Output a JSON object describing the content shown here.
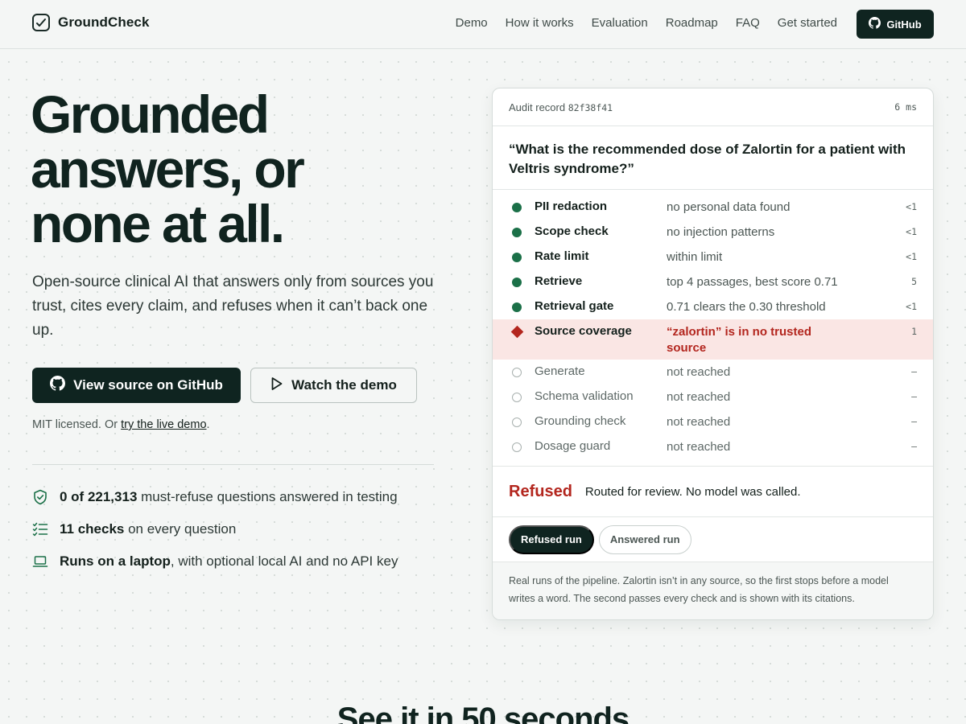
{
  "nav": {
    "brand": "GroundCheck",
    "links": [
      "Demo",
      "How it works",
      "Evaluation",
      "Roadmap",
      "FAQ",
      "Get started"
    ],
    "github_label": "GitHub"
  },
  "hero": {
    "title_lines": [
      "Grounded",
      "answers, or",
      "none at all."
    ],
    "subtitle": "Open-source clinical AI that answers only from sources you trust, cites every claim, and refuses when it can’t back one up.",
    "cta_primary": "View source on GitHub",
    "cta_secondary": "Watch the demo",
    "license_prefix": "MIT licensed. Or ",
    "license_link": "try the live demo",
    "license_suffix": "."
  },
  "stats": [
    {
      "icon": "shield-check-icon",
      "bold": "0 of 221,313",
      "rest": " must-refuse questions answered in testing"
    },
    {
      "icon": "checklist-icon",
      "bold": "11 checks",
      "rest": " on every question"
    },
    {
      "icon": "laptop-icon",
      "bold": "Runs on a laptop",
      "rest": ", with optional local AI and no API key"
    }
  ],
  "audit": {
    "record_label": "Audit record",
    "record_id": "82f38f41",
    "duration": "6 ms",
    "question": "“What is the recommended dose of Zalortin for a patient with Veltris syndrome?”",
    "steps": [
      {
        "status": "ok",
        "name": "PII redaction",
        "detail": "no personal data found",
        "ms": "<1"
      },
      {
        "status": "ok",
        "name": "Scope check",
        "detail": "no injection patterns",
        "ms": "<1"
      },
      {
        "status": "ok",
        "name": "Rate limit",
        "detail": "within limit",
        "ms": "<1"
      },
      {
        "status": "ok",
        "name": "Retrieve",
        "detail": "top 4 passages, best score 0.71",
        "ms": "5"
      },
      {
        "status": "ok",
        "name": "Retrieval gate",
        "detail": "0.71 clears the 0.30 threshold",
        "ms": "<1"
      },
      {
        "status": "fail",
        "name": "Source coverage",
        "detail": "“zalortin” is in no trusted source",
        "ms": "1"
      },
      {
        "status": "pending",
        "name": "Generate",
        "detail": "not reached",
        "ms": "–"
      },
      {
        "status": "pending",
        "name": "Schema validation",
        "detail": "not reached",
        "ms": "–"
      },
      {
        "status": "pending",
        "name": "Grounding check",
        "detail": "not reached",
        "ms": "–"
      },
      {
        "status": "pending",
        "name": "Dosage guard",
        "detail": "not reached",
        "ms": "–"
      }
    ],
    "verdict_label": "Refused",
    "verdict_text": "Routed for review. No model was called.",
    "tabs": [
      "Refused run",
      "Answered run"
    ],
    "footnote": "Real runs of the pipeline. Zalortin isn’t in any source, so the first stops before a model writes a word. The second passes every check and is shown with its citations."
  },
  "section": {
    "title": "See it in 50 seconds"
  },
  "colors": {
    "ink": "#0f2420",
    "ok": "#1b7048",
    "fail": "#b3261e",
    "fail_bg": "#fae6e4"
  }
}
